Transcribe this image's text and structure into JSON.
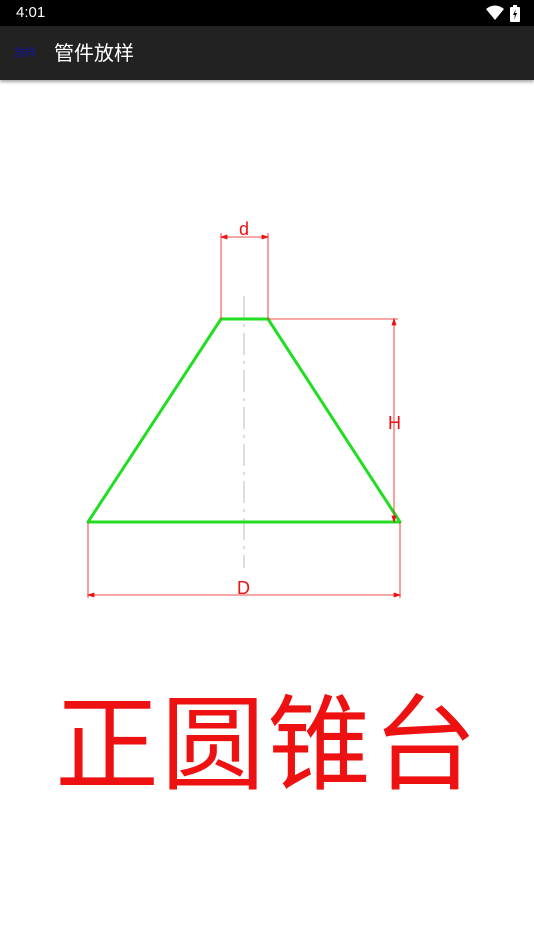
{
  "status_bar": {
    "time": "4:01"
  },
  "toolbar": {
    "app_icon_text": "放样",
    "title": "管件放样"
  },
  "drawing": {
    "labels": {
      "top_diameter": "d",
      "height": "H",
      "bottom_diameter": "D"
    },
    "colors": {
      "outline": "#22dd22",
      "dimension": "#ee1111",
      "centerline": "#bbbbbb"
    }
  },
  "caption": "正圆锥台"
}
